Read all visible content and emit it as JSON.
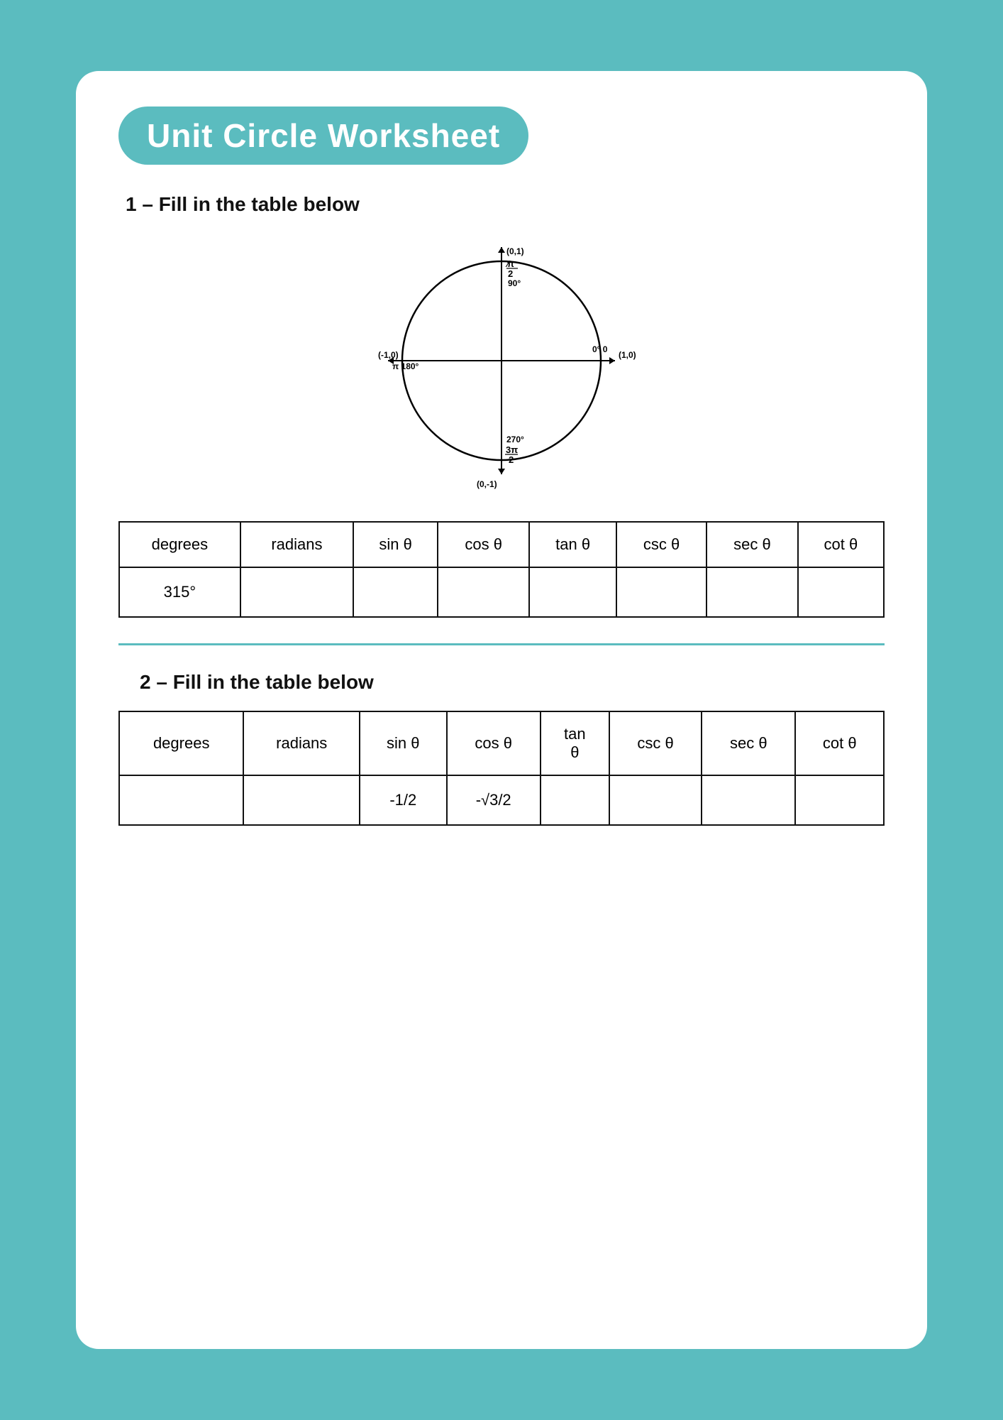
{
  "page": {
    "title": "Unit Circle Worksheet",
    "background_color": "#5bbcbf"
  },
  "section1": {
    "heading": "1 – Fill in the table below",
    "table": {
      "headers": [
        "degrees",
        "radians",
        "sin θ",
        "cos θ",
        "tan θ",
        "csc θ",
        "sec θ",
        "cot θ"
      ],
      "rows": [
        [
          "315°",
          "",
          "",
          "",
          "",
          "",
          "",
          ""
        ]
      ]
    }
  },
  "section2": {
    "heading": "2 – Fill in the table below",
    "table": {
      "headers": [
        "degrees",
        "radians",
        "sin θ",
        "cos θ",
        "tan\nθ",
        "csc θ",
        "sec θ",
        "cot θ"
      ],
      "rows": [
        [
          "",
          "",
          "-1/2",
          "-√3/2",
          "",
          "",
          "",
          ""
        ]
      ]
    }
  },
  "circle": {
    "points": {
      "top": "(0,1)",
      "bottom": "(0,-1)",
      "left": "(-1,0)",
      "right": "(1,0)"
    },
    "labels": {
      "top_angle": "π/2",
      "top_degrees": "90°",
      "right_angle": "0° 0",
      "bottom_angle": "270°",
      "bottom_frac": "3π/2",
      "left_angle": "π  180°"
    }
  }
}
